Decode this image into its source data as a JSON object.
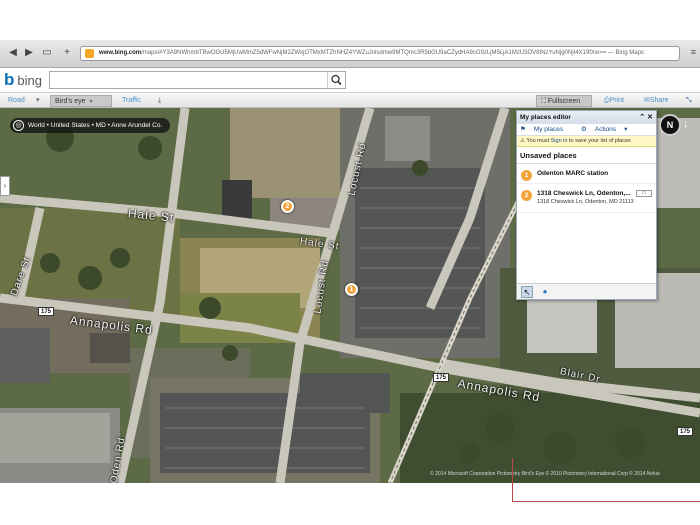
{
  "browser": {
    "url_domain": "www.bing.com",
    "url_rest": "/maps/#Y3A9NWhmbTBwOGU5MjUwMmZ5dWFwNjM2ZWxjOTMxMTZhNHZ4YWZuJnlsdmw9MTQmc3R5bGU9aCZydHA9cG9zLjM5LjA1MzU3OV8tNzYuNjg0NjI4X19fXw== — Bing Maps"
  },
  "search": {
    "value": ""
  },
  "logo": {
    "text": "bing"
  },
  "toolbar": {
    "road": "Road",
    "birds_eye": "Bird's eye",
    "traffic": "Traffic",
    "fullscreen": "Fullscreen",
    "print": "Print",
    "share": "Share"
  },
  "map": {
    "breadcrumb": "World • United States • MD • Anne Arundel Co.",
    "streets": {
      "hale": "Hale St",
      "hale_east": "Hale St",
      "dare": "Dare St",
      "annapolis_west": "Annapolis Rd",
      "annapolis_east": "Annapolis Rd",
      "locust_north": "Locust Rd",
      "locust_mid": "Locust Rd",
      "blair": "Blair Dr",
      "bottom": "Oden Rd"
    },
    "shields": {
      "west": "175",
      "center": "175",
      "east": "175"
    },
    "pins": {
      "one": "1",
      "two": "2"
    },
    "compass_label": "N",
    "copyright": "© 2014 Microsoft Corporation   Pictometry Bird's Eye © 2010 Pictometry International Corp   © 2014 Nokia"
  },
  "places_editor": {
    "title": "My places editor",
    "tab_my_places": "My places",
    "tab_actions": "Actions",
    "signin_prefix": "You must",
    "signin_link": "Sign in",
    "signin_suffix": "to save your list of places",
    "section": "Unsaved places",
    "places": [
      {
        "number": "1",
        "name": "Odenton MARC station",
        "address": ""
      },
      {
        "number": "2",
        "name": "1318 Cheswick Ln, Odenton,...",
        "address": "1318 Cheswick Ln, Odenton, MD 21113"
      }
    ]
  },
  "colors": {
    "bing_blue": "#0b6fb5",
    "pin_orange": "#f3a33c",
    "link_blue": "#4a90c8"
  }
}
